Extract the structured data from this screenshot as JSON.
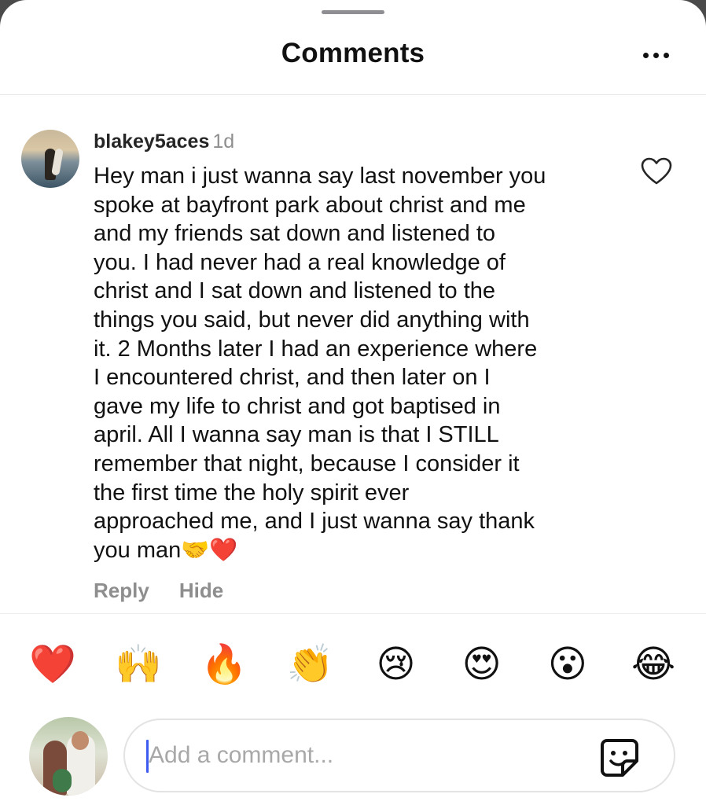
{
  "header": {
    "title": "Comments"
  },
  "comment": {
    "username": "blakey5aces",
    "time": "1d",
    "lines": [
      "Hey man i just wanna say last november you",
      "spoke at bayfront park about christ and me",
      "and my friends sat down and listened to",
      "you. I had never had a real knowledge of",
      "christ and I sat down and listened to the",
      "things you said, but never did anything with",
      "it. 2 Months later I had an experience where",
      "I encountered christ, and then later on I",
      "gave my life to christ and got baptised in",
      "april. All I wanna say man is that I STILL",
      "remember that night, because I consider it",
      "the first time the holy spirit ever",
      "approached me, and I just wanna say thank",
      "you man🤝❤️"
    ],
    "reply_label": "Reply",
    "hide_label": "Hide"
  },
  "reactions": [
    "❤️",
    "🙌",
    "🔥",
    "👏",
    "😢",
    "😍",
    "😮",
    "😂"
  ],
  "composer": {
    "placeholder": "Add a comment..."
  },
  "icons": {
    "more": "more-horizontal-icon",
    "like": "heart-outline-icon",
    "sticker": "sticker-icon"
  },
  "colors": {
    "caret": "#3d5af1",
    "muted": "#8e8e8e"
  }
}
